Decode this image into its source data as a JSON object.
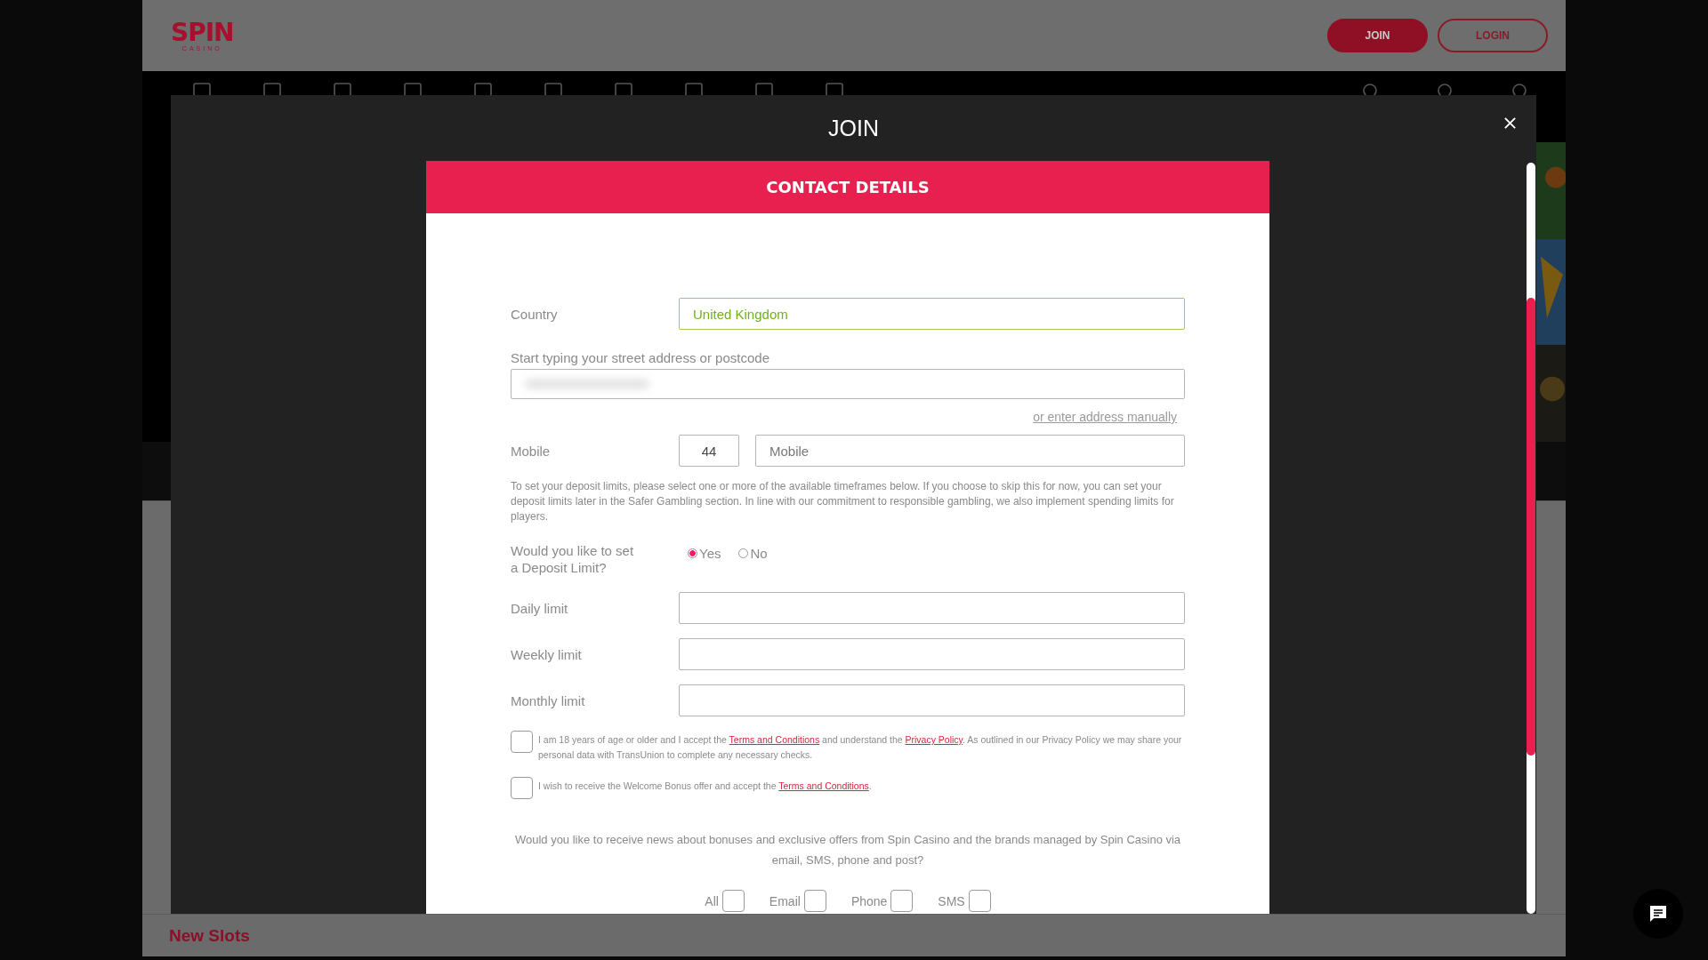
{
  "header": {
    "logo": {
      "word": "SPIN",
      "tagline": "CASINO"
    },
    "buttons": [
      {
        "label": "JOIN",
        "kind": "primary"
      },
      {
        "label": "LOGIN",
        "kind": "outline"
      }
    ]
  },
  "modal": {
    "title": "JOIN",
    "form": {
      "heading": "CONTACT DETAILS",
      "country": {
        "label": "Country",
        "value": "United Kingdom",
        "valid": true
      },
      "address": {
        "label": "Start typing your street address or postcode",
        "link": "or enter address manually"
      },
      "mobile": {
        "label": "Mobile",
        "code": "44",
        "placeholder": "Mobile"
      },
      "notice": "To set your deposit limits, please select one or more of the available timeframes below. If you choose to skip this for now, you can set your deposit limits later in the Safer Gambling section. In line with our commitment to responsible gambling, we also implement spending limits for players.",
      "deposit_limit": {
        "question": "Would you like to set a Deposit Limit?",
        "options": [
          {
            "label": "Yes",
            "selected": true
          },
          {
            "label": "No",
            "selected": false
          }
        ]
      },
      "limits": [
        {
          "label": "Daily limit"
        },
        {
          "label": "Weekly limit"
        },
        {
          "label": "Monthly limit"
        }
      ],
      "consents": [
        {
          "checked": false,
          "segments": [
            {
              "kind": "text",
              "text": "I am 18 years of age or older and I accept the "
            },
            {
              "kind": "link",
              "text": "Terms and Conditions"
            },
            {
              "kind": "text",
              "text": " and understand the "
            },
            {
              "kind": "link",
              "text": "Privacy Policy"
            },
            {
              "kind": "text",
              "text": ". As outlined in our Privacy Policy we may share your personal data with TransUnion to complete any necessary checks."
            }
          ]
        },
        {
          "checked": false,
          "segments": [
            {
              "kind": "text",
              "text": "I wish to receive the Welcome Bonus offer and accept the "
            },
            {
              "kind": "link",
              "text": "Terms and Conditions"
            },
            {
              "kind": "text",
              "text": "."
            }
          ]
        }
      ],
      "marketing": {
        "question": "Would you like to receive news about bonuses and exclusive offers from Spin Casino and the brands managed by Spin Casino via email, SMS, phone and post?",
        "channels": [
          {
            "label": "All",
            "checked": false
          },
          {
            "label": "Email",
            "checked": false
          },
          {
            "label": "Phone",
            "checked": false
          },
          {
            "label": "SMS",
            "checked": false
          }
        ]
      }
    }
  },
  "background": {
    "section_title": "New Slots"
  }
}
